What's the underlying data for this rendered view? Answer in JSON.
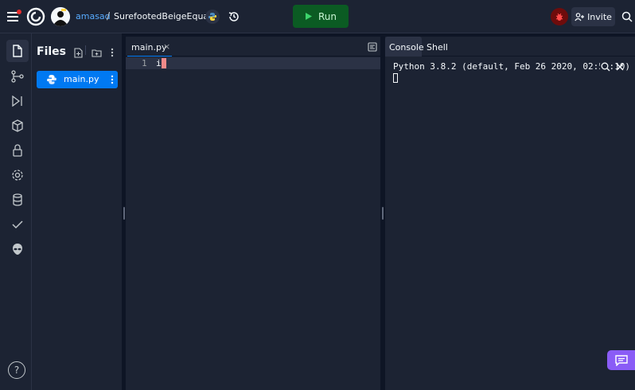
{
  "header": {
    "username": "amasad",
    "separator": "/",
    "repl_name": "SurefootedBeigeEqua...",
    "run_label": "Run",
    "invite_label": "Invite"
  },
  "files_panel": {
    "title": "Files",
    "files": [
      {
        "name": "main.py",
        "icon": "python-icon",
        "selected": true
      }
    ]
  },
  "editor": {
    "tab_label": "main.py",
    "tab_close": "×",
    "lines": [
      {
        "number": "1",
        "text": "i"
      }
    ]
  },
  "console": {
    "tabs": [
      {
        "label": "Console",
        "active": true
      },
      {
        "label": "Shell",
        "active": false
      }
    ],
    "output": "Python 3.8.2 (default, Feb 26 2020, 02:56:10)"
  },
  "footer": {
    "help_label": "?"
  },
  "colors": {
    "run_green": "#0b5b23",
    "selected_blue": "#0079f2",
    "chat_purple": "#8a5cf6",
    "cursor": "#f08a8a"
  }
}
